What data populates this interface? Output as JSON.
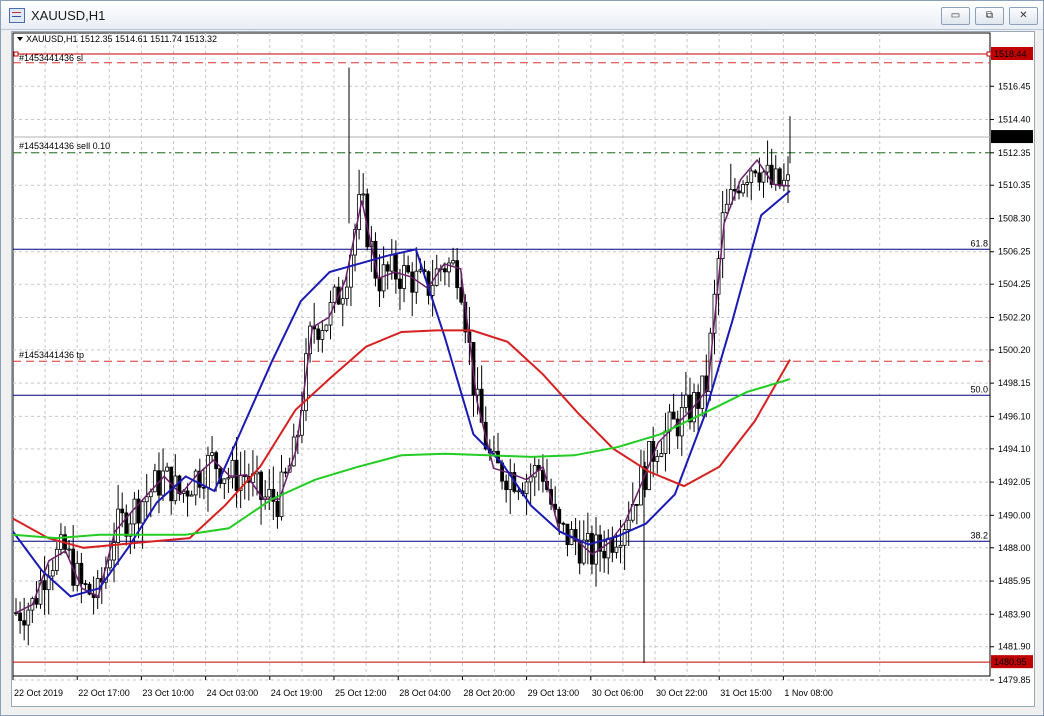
{
  "window": {
    "title": "XAUUSD,H1",
    "minimize_glyph": "▭",
    "maximize_glyph": "⧉",
    "close_glyph": "✕"
  },
  "chart": {
    "header": "XAUUSD,H1  1512.35 1514.61 1511.74 1513.32",
    "order_sl_label": "#1453441436 sl",
    "order_entry_label": "#1453441436 sell 0.10",
    "order_tp_label": "#1453441436 tp",
    "fib_labels": [
      "61.8",
      "50.0",
      "38.2"
    ],
    "price_ticks": [
      "1516.45",
      "1514.40",
      "1512.35",
      "1510.35",
      "1508.30",
      "1506.25",
      "1504.25",
      "1502.20",
      "1500.20",
      "1498.15",
      "1496.10",
      "1494.10",
      "1492.05",
      "1490.00",
      "1488.00",
      "1485.95",
      "1483.90",
      "1481.90",
      "1479.85"
    ],
    "time_ticks": [
      "22 Oct 2019",
      "22 Oct 17:00",
      "23 Oct 10:00",
      "24 Oct 03:00",
      "24 Oct 19:00",
      "25 Oct 12:00",
      "28 Oct 04:00",
      "28 Oct 20:00",
      "29 Oct 13:00",
      "30 Oct 06:00",
      "30 Oct 22:00",
      "31 Oct 15:00",
      "1 Nov 08:00"
    ],
    "price_tags": {
      "top_line": "1518.44",
      "current": "1513.32",
      "bottom_line": "1480.95"
    }
  },
  "chart_data": {
    "type": "candlestick",
    "symbol": "XAUUSD",
    "timeframe": "H1",
    "ohlc_last": {
      "open": 1512.35,
      "high": 1514.61,
      "low": 1511.74,
      "close": 1513.32
    },
    "ylim": [
      1479.85,
      1518.44
    ],
    "horizontal_levels": [
      {
        "name": "top line",
        "price": 1518.44,
        "color": "#c00000"
      },
      {
        "name": "#1453441436 sl",
        "price": 1517.9,
        "color": "#e03030",
        "style": "dashed"
      },
      {
        "name": "current price",
        "price": 1513.32,
        "color": "#b0b0b0"
      },
      {
        "name": "#1453441436 sell 0.10",
        "price": 1512.35,
        "color": "#207020",
        "style": "dashdot"
      },
      {
        "name": "61.8",
        "price": 1506.4,
        "color": "#000080"
      },
      {
        "name": "#1453441436 tp",
        "price": 1499.5,
        "color": "#e03030",
        "style": "dashed"
      },
      {
        "name": "50.0",
        "price": 1497.4,
        "color": "#000080"
      },
      {
        "name": "38.2",
        "price": 1488.4,
        "color": "#000080"
      },
      {
        "name": "bottom line",
        "price": 1480.95,
        "color": "#c00000"
      }
    ],
    "ma_series": [
      {
        "color": "#6b1f6b",
        "values": [
          1484.0,
          1484.5,
          1487.2,
          1487.8,
          1485.5,
          1485.0,
          1489.0,
          1490.2,
          1491.3,
          1492.4,
          1491.3,
          1492.5,
          1493.4,
          1492.4,
          1492.5,
          1491.0,
          1491.0,
          1494.0,
          1501.6,
          1502.2,
          1504.5,
          1509.4,
          1504.6,
          1505.0,
          1504.7,
          1504.0,
          1505.5,
          1505.2,
          1497.0,
          1492.9,
          1492.6,
          1492.2,
          1493.0,
          1489.0,
          1488.5,
          1487.6,
          1488.3,
          1489.6,
          1492.0,
          1494.5,
          1495.5,
          1496.5,
          1497.8,
          1508.0,
          1510.7,
          1511.9,
          1510.4,
          1510.3
        ]
      },
      {
        "color": "#1a1ab4",
        "values": [
          1489.0,
          1486.6,
          1485.0,
          1485.5,
          1488.0,
          1490.8,
          1492.4,
          1491.5,
          1495.5,
          1499.5,
          1503.2,
          1505.0,
          1505.5,
          1506.0,
          1506.4,
          1501.0,
          1495.0,
          1493.2,
          1490.6,
          1489.0,
          1488.2,
          1488.7,
          1489.5,
          1491.3,
          1496.0,
          1502.0,
          1508.5,
          1510.0
        ]
      },
      {
        "color": "#d62020",
        "values": [
          1489.8,
          1488.6,
          1488.0,
          1488.2,
          1488.4,
          1488.6,
          1490.6,
          1493.0,
          1496.5,
          1498.5,
          1500.4,
          1501.3,
          1501.4,
          1501.4,
          1500.7,
          1498.7,
          1496.3,
          1494.1,
          1492.7,
          1491.8,
          1493.0,
          1495.8,
          1499.6
        ]
      },
      {
        "color": "#22cc22",
        "values": [
          1488.8,
          1488.6,
          1488.8,
          1488.8,
          1488.8,
          1489.2,
          1491.0,
          1492.2,
          1493.0,
          1493.7,
          1493.8,
          1493.7,
          1493.6,
          1493.7,
          1494.2,
          1495.0,
          1496.3,
          1497.6,
          1498.4
        ]
      }
    ]
  }
}
